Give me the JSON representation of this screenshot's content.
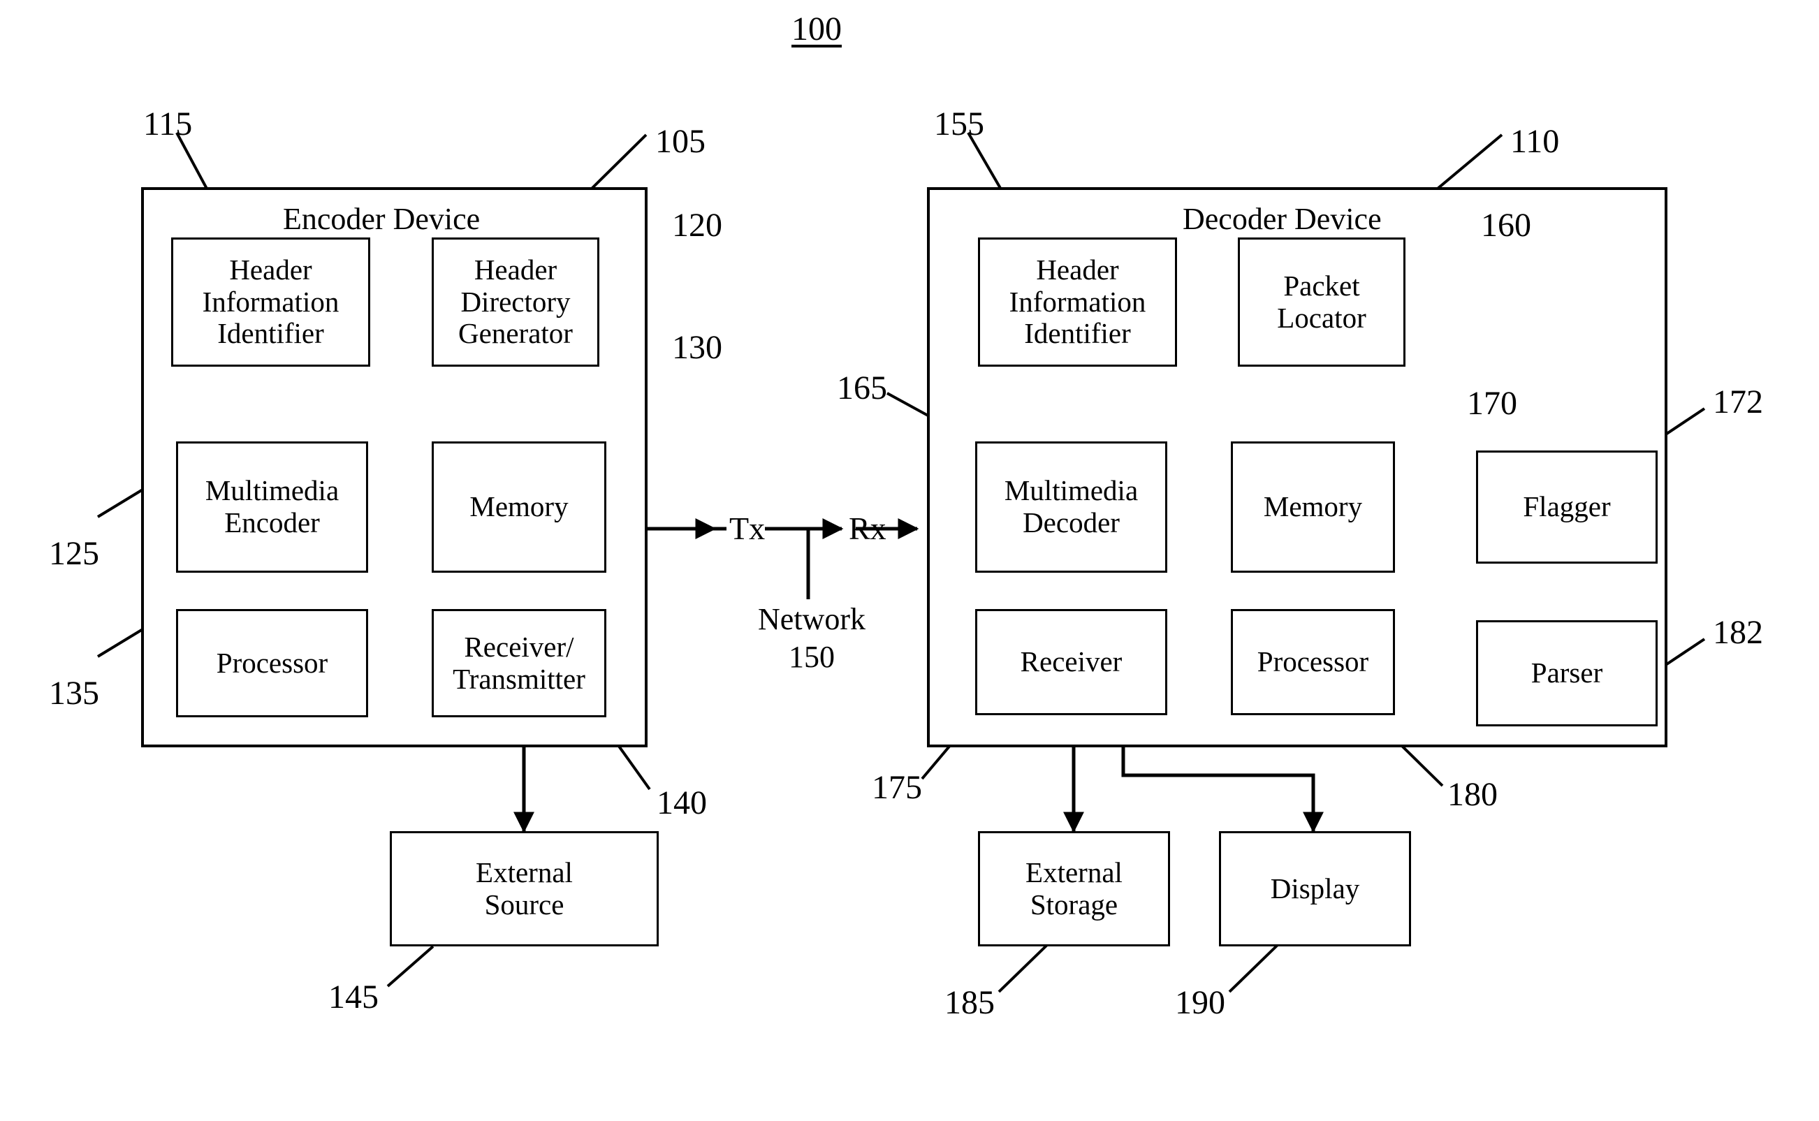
{
  "figure": {
    "number": "100"
  },
  "devices": [
    {
      "id": "encoder",
      "title": "Encoder Device",
      "ref": "105"
    },
    {
      "id": "decoder",
      "title": "Decoder Device",
      "ref": "110"
    }
  ],
  "blocks": [
    {
      "id": "header-info-identifier-enc",
      "label": "Header\nInformation\nIdentifier",
      "ref": "115"
    },
    {
      "id": "header-directory-generator",
      "label": "Header\nDirectory\nGenerator",
      "ref": "120"
    },
    {
      "id": "multimedia-encoder",
      "label": "Multimedia\nEncoder",
      "ref": "125"
    },
    {
      "id": "memory-enc",
      "label": "Memory",
      "ref": "130"
    },
    {
      "id": "processor-enc",
      "label": "Processor",
      "ref": "135"
    },
    {
      "id": "receiver-transmitter",
      "label": "Receiver/\nTransmitter",
      "ref": "140"
    },
    {
      "id": "external-source",
      "label": "External\nSource",
      "ref": "145"
    },
    {
      "id": "header-info-identifier-dec",
      "label": "Header\nInformation\nIdentifier",
      "ref": "155"
    },
    {
      "id": "packet-locator",
      "label": "Packet\nLocator",
      "ref": "160"
    },
    {
      "id": "multimedia-decoder",
      "label": "Multimedia\nDecoder",
      "ref": "165"
    },
    {
      "id": "memory-dec",
      "label": "Memory",
      "ref": "170"
    },
    {
      "id": "flagger",
      "label": "Flagger",
      "ref": "172"
    },
    {
      "id": "receiver-dec",
      "label": "Receiver",
      "ref": "175"
    },
    {
      "id": "processor-dec",
      "label": "Processor",
      "ref": "180"
    },
    {
      "id": "parser",
      "label": "Parser",
      "ref": "182"
    },
    {
      "id": "external-storage",
      "label": "External\nStorage",
      "ref": "185"
    },
    {
      "id": "display",
      "label": "Display",
      "ref": "190"
    }
  ],
  "signals": {
    "tx": "Tx",
    "rx": "Rx"
  },
  "network": {
    "label": "Network\n150",
    "name": "Network",
    "ref": "150"
  },
  "refs": {
    "r100": "100",
    "r105": "105",
    "r110": "110",
    "r115": "115",
    "r120": "120",
    "r125": "125",
    "r130": "130",
    "r135": "135",
    "r140": "140",
    "r145": "145",
    "r150": "150",
    "r155": "155",
    "r160": "160",
    "r165": "165",
    "r170": "170",
    "r172": "172",
    "r175": "175",
    "r180": "180",
    "r182": "182",
    "r185": "185",
    "r190": "190"
  },
  "labels": {
    "encoder_device": "Encoder Device",
    "decoder_device": "Decoder Device",
    "header_info_identifier": "Header\nInformation\nIdentifier",
    "header_directory_generator": "Header\nDirectory\nGenerator",
    "multimedia_encoder": "Multimedia\nEncoder",
    "memory": "Memory",
    "processor": "Processor",
    "receiver_transmitter": "Receiver/\nTransmitter",
    "external_source": "External\nSource",
    "packet_locator": "Packet\nLocator",
    "multimedia_decoder": "Multimedia\nDecoder",
    "flagger": "Flagger",
    "receiver": "Receiver",
    "parser": "Parser",
    "external_storage": "External\nStorage",
    "display": "Display"
  },
  "colors": {
    "line": "#000000",
    "background": "#ffffff"
  }
}
